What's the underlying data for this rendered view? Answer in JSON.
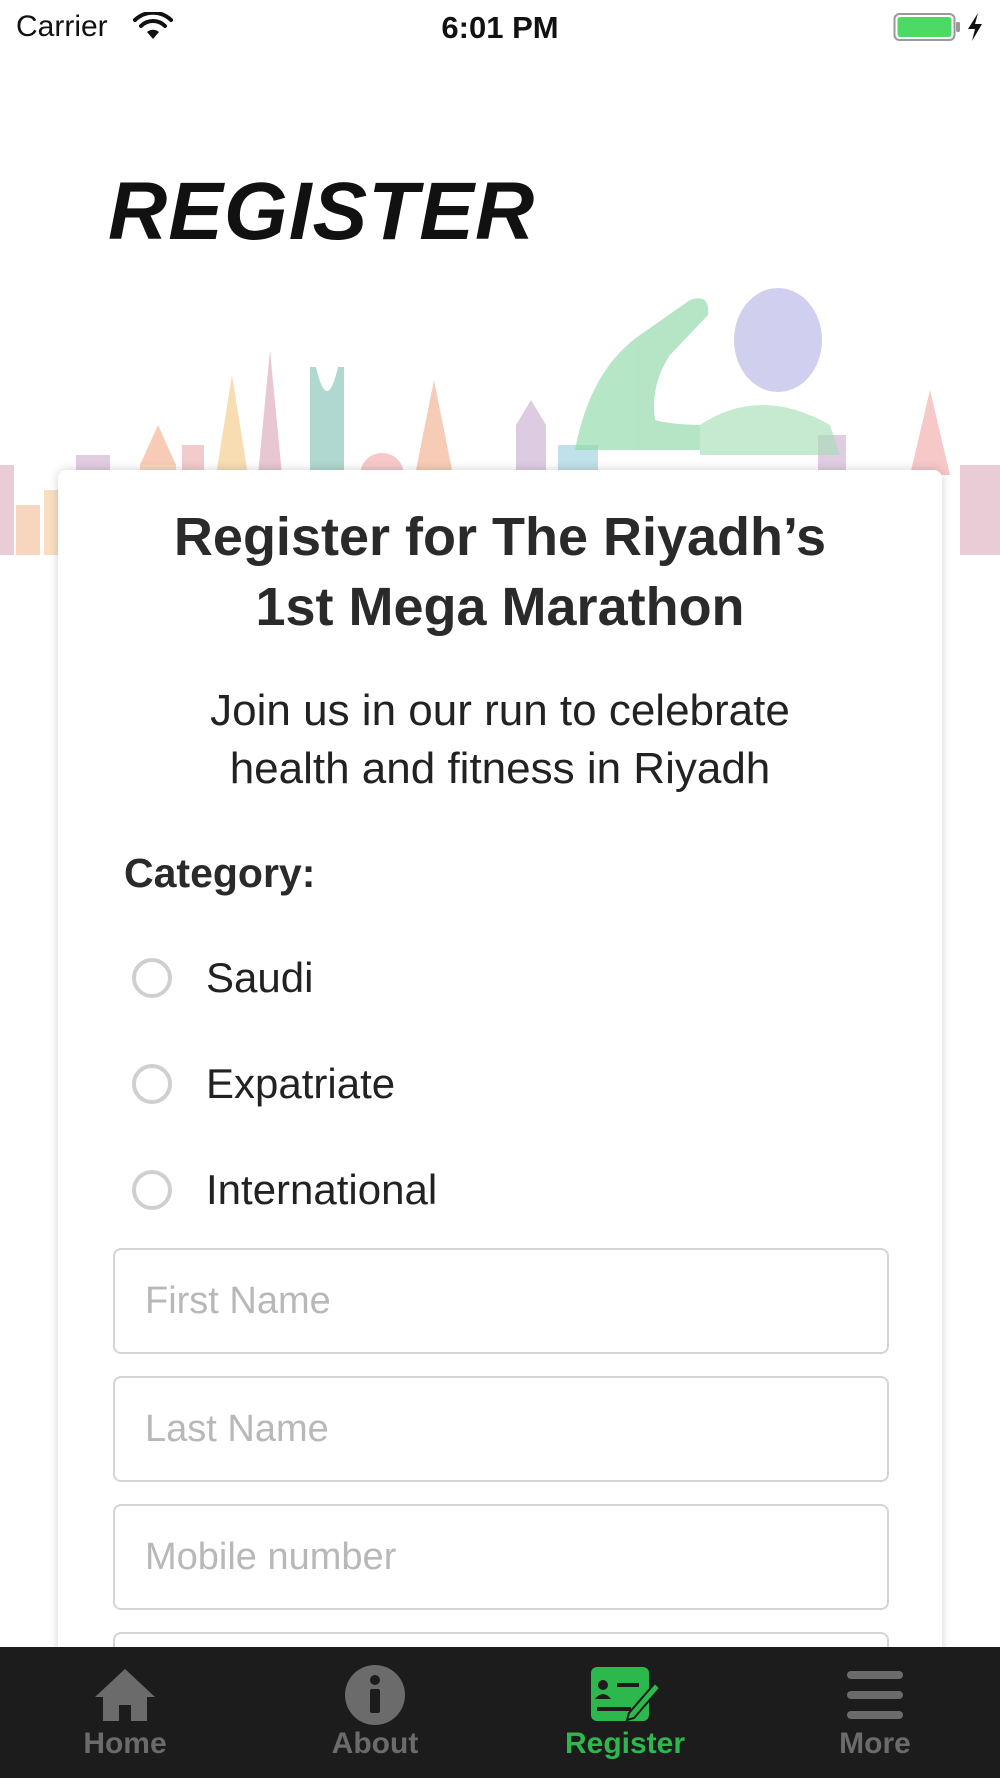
{
  "status_bar": {
    "carrier": "Carrier",
    "time": "6:01 PM",
    "battery_color": "#4cd964"
  },
  "header": {
    "title": "REGISTER"
  },
  "card": {
    "title_line1": "Register for The Riyadh’s",
    "title_line2": "1st Mega Marathon",
    "subtitle_line1": "Join us in our run to celebrate",
    "subtitle_line2": "health and fitness in Riyadh",
    "category_label": "Category:",
    "categories": [
      {
        "label": "Saudi",
        "selected": false
      },
      {
        "label": "Expatriate",
        "selected": false
      },
      {
        "label": "International",
        "selected": false
      }
    ],
    "fields": {
      "first_name_placeholder": "First Name",
      "last_name_placeholder": "Last Name",
      "mobile_placeholder": "Mobile number"
    }
  },
  "tab_bar": {
    "active_color": "#2db84d",
    "inactive_color": "#6b6b6b",
    "tabs": [
      {
        "label": "Home",
        "icon": "home-icon",
        "active": false
      },
      {
        "label": "About",
        "icon": "info-icon",
        "active": false
      },
      {
        "label": "Register",
        "icon": "register-form-icon",
        "active": true
      },
      {
        "label": "More",
        "icon": "hamburger-menu-icon",
        "active": false
      }
    ]
  }
}
